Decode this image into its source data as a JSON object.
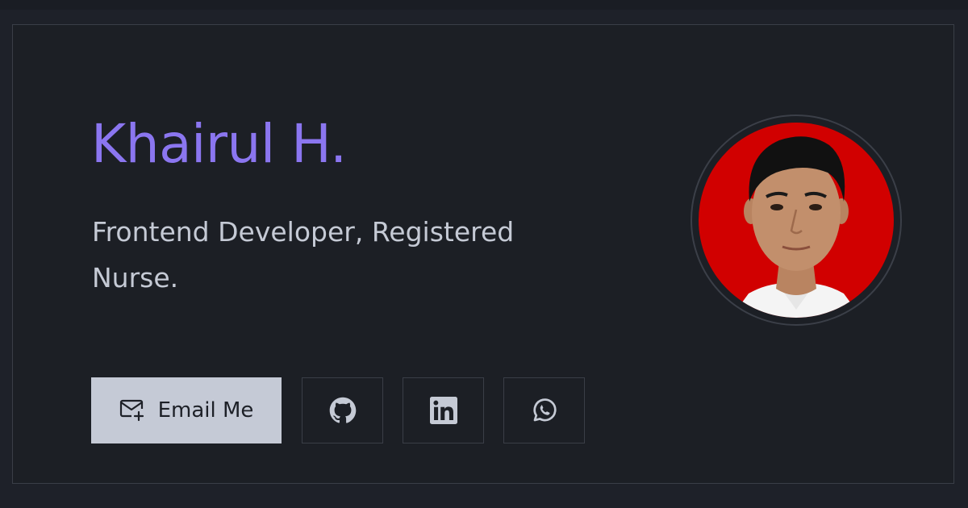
{
  "profile": {
    "name": "Khairul H.",
    "subtitle": "Frontend Developer, Registered Nurse."
  },
  "actions": {
    "email_label": "Email Me",
    "icons": [
      "mail-plus-icon",
      "github-icon",
      "linkedin-icon",
      "whatsapp-icon"
    ]
  },
  "colors": {
    "background": "#1e2129",
    "card": "#1c1f25",
    "accent": "#8b76f0",
    "text": "#c5cad5",
    "email_button": "#c5cad6",
    "border": "#3a3e47",
    "avatar_background": "#d10000"
  }
}
